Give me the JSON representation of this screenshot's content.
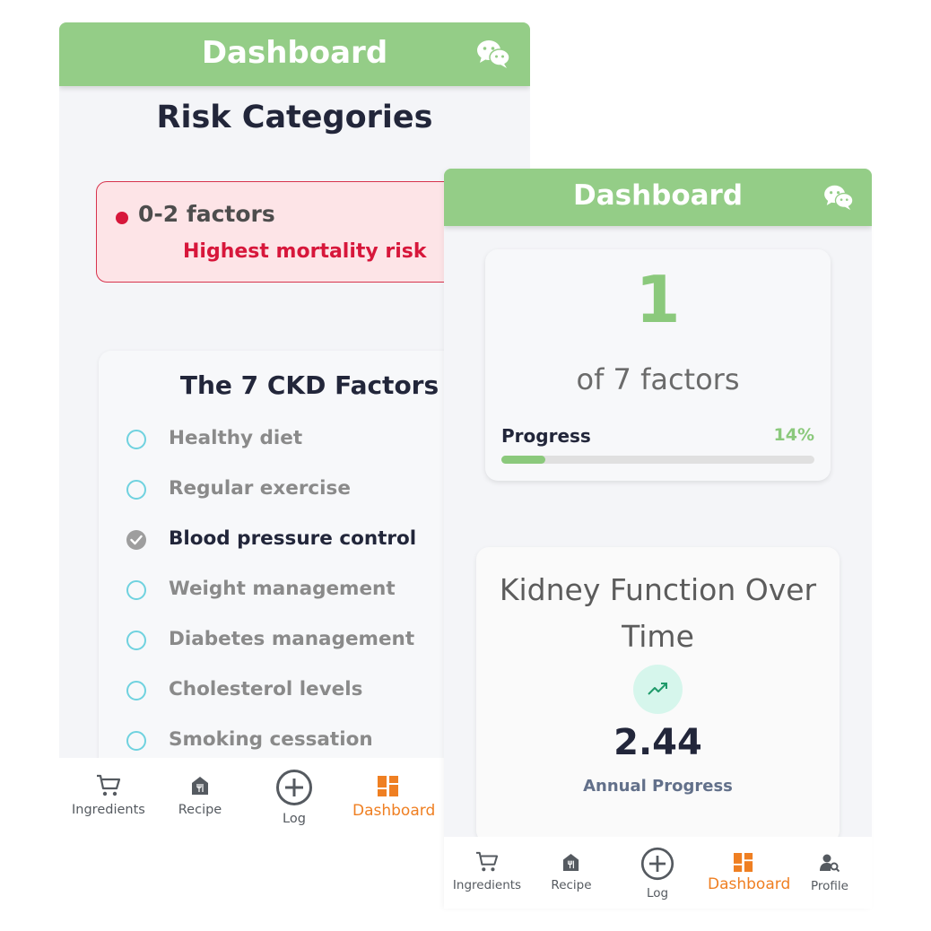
{
  "left_screen": {
    "app_bar": {
      "title": "Dashboard",
      "icon": "wechat-icon"
    },
    "risk_section": {
      "title": "Risk Categories",
      "card": {
        "range": "0-2 factors",
        "description": "Highest mortality risk",
        "color": "#d7173b"
      }
    },
    "factors_card": {
      "title": "The 7 CKD Factors",
      "items": [
        {
          "label": "Healthy diet",
          "checked": false
        },
        {
          "label": "Regular exercise",
          "checked": false
        },
        {
          "label": "Blood pressure control",
          "checked": true
        },
        {
          "label": "Weight management",
          "checked": false
        },
        {
          "label": "Diabetes management",
          "checked": false
        },
        {
          "label": "Cholesterol levels",
          "checked": false
        },
        {
          "label": "Smoking cessation",
          "checked": false
        }
      ]
    },
    "nav": {
      "items": [
        {
          "label": "Ingredients",
          "icon": "cart-icon",
          "active": false
        },
        {
          "label": "Recipe",
          "icon": "recipe-icon",
          "active": false
        },
        {
          "label": "Log",
          "icon": "plus-circle-icon",
          "active": false
        },
        {
          "label": "Dashboard",
          "icon": "dashboard-icon",
          "active": true
        }
      ]
    }
  },
  "right_screen": {
    "app_bar": {
      "title": "Dashboard",
      "icon": "wechat-icon"
    },
    "score_card": {
      "value": "1",
      "subtitle": "of 7 factors",
      "progress_label": "Progress",
      "progress_percent_text": "14%",
      "progress_fraction": 0.14
    },
    "kidney_card": {
      "title": "Kidney Function Over Time",
      "trend_icon": "trending-up-icon",
      "value": "2.44",
      "subtitle": "Annual Progress"
    },
    "nav": {
      "items": [
        {
          "label": "Ingredients",
          "icon": "cart-icon",
          "active": false
        },
        {
          "label": "Recipe",
          "icon": "recipe-icon",
          "active": false
        },
        {
          "label": "Log",
          "icon": "plus-circle-icon",
          "active": false
        },
        {
          "label": "Dashboard",
          "icon": "dashboard-icon",
          "active": true
        },
        {
          "label": "Profile",
          "icon": "profile-search-icon",
          "active": false
        }
      ]
    }
  },
  "colors": {
    "app_bar": "#94cd87",
    "accent_green": "#8bc97c",
    "active_nav": "#ef7f22",
    "risk_red": "#d7173b",
    "unchecked_ring": "#6fd2df"
  }
}
